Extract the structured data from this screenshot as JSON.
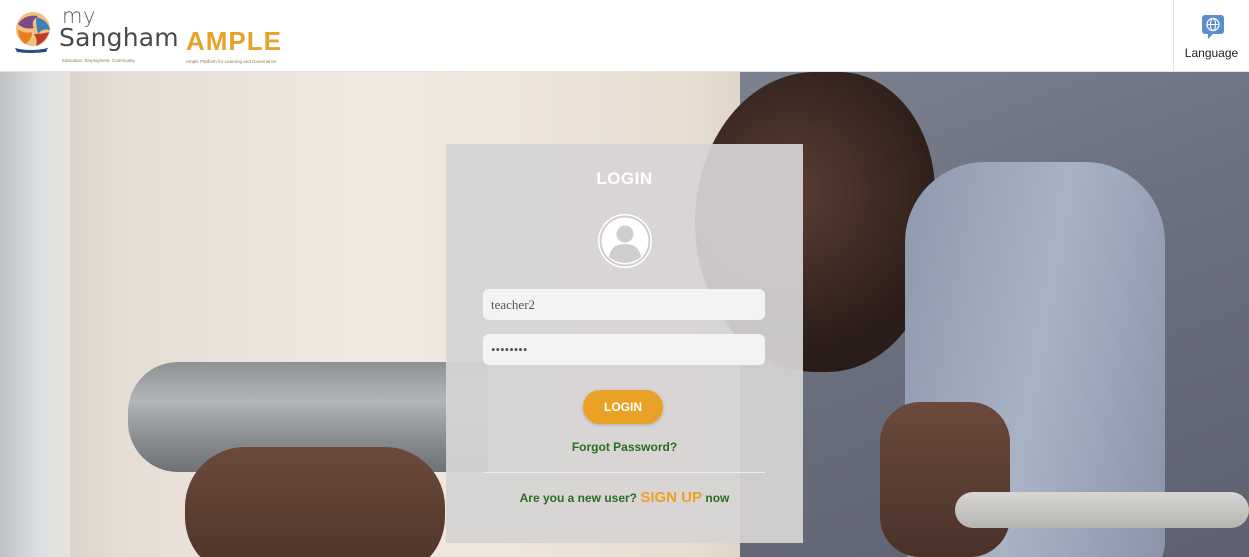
{
  "header": {
    "logo": {
      "my": "my",
      "sangham": "Sangham",
      "tagline": "Education. Employment. Community.",
      "ample": "AMPLE",
      "ample_tagline": "Ample Platform for Learning and Governance"
    },
    "language_button": {
      "label": "Language",
      "icon": "language-icon"
    }
  },
  "login_panel": {
    "title": "LOGIN",
    "avatar_icon": "user-avatar-icon",
    "username_value": "teacher2",
    "password_value": "••••••••",
    "login_button": "LOGIN",
    "forgot_password": "Forgot Password?",
    "signup_prefix": "Are you a new user?",
    "signup_link": "SIGN UP",
    "signup_suffix": "now"
  },
  "colors": {
    "accent": "#e9a226",
    "link_green": "#2a6e22",
    "panel_bg": "#d6d4d4"
  }
}
